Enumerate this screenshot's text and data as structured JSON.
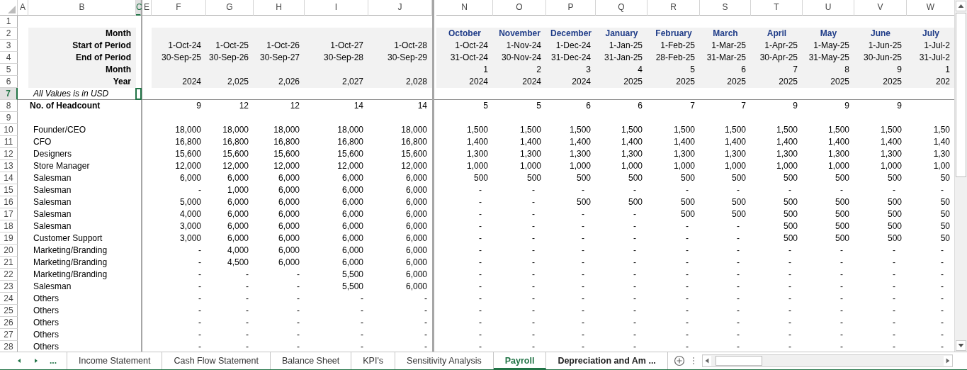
{
  "column_headers": [
    {
      "label": "A",
      "selected": false
    },
    {
      "label": "B",
      "selected": false
    },
    {
      "label": "C",
      "selected": true
    },
    {
      "label": "E",
      "selected": false
    },
    {
      "label": "F",
      "selected": false
    },
    {
      "label": "G",
      "selected": false
    },
    {
      "label": "H",
      "selected": false
    },
    {
      "label": "I",
      "selected": false
    },
    {
      "label": "J",
      "selected": false
    },
    {
      "label": "N",
      "selected": false
    },
    {
      "label": "O",
      "selected": false
    },
    {
      "label": "P",
      "selected": false
    },
    {
      "label": "Q",
      "selected": false
    },
    {
      "label": "R",
      "selected": false
    },
    {
      "label": "S",
      "selected": false
    },
    {
      "label": "T",
      "selected": false
    },
    {
      "label": "U",
      "selected": false
    },
    {
      "label": "V",
      "selected": false
    },
    {
      "label": "W",
      "selected": false
    }
  ],
  "row_numbers": [
    {
      "label": "1",
      "selected": false
    },
    {
      "label": "2",
      "selected": false
    },
    {
      "label": "3",
      "selected": false
    },
    {
      "label": "4",
      "selected": false
    },
    {
      "label": "5",
      "selected": false
    },
    {
      "label": "6",
      "selected": false
    },
    {
      "label": "7",
      "selected": true
    },
    {
      "label": "8",
      "selected": false
    },
    {
      "label": "9",
      "selected": false
    },
    {
      "label": "10",
      "selected": false
    },
    {
      "label": "11",
      "selected": false
    },
    {
      "label": "12",
      "selected": false
    },
    {
      "label": "13",
      "selected": false
    },
    {
      "label": "14",
      "selected": false
    },
    {
      "label": "15",
      "selected": false
    },
    {
      "label": "16",
      "selected": false
    },
    {
      "label": "17",
      "selected": false
    },
    {
      "label": "18",
      "selected": false
    },
    {
      "label": "19",
      "selected": false
    },
    {
      "label": "20",
      "selected": false
    },
    {
      "label": "21",
      "selected": false
    },
    {
      "label": "22",
      "selected": false
    },
    {
      "label": "23",
      "selected": false
    },
    {
      "label": "24",
      "selected": false
    },
    {
      "label": "25",
      "selected": false
    },
    {
      "label": "26",
      "selected": false
    },
    {
      "label": "27",
      "selected": false
    },
    {
      "label": "28",
      "selected": false
    }
  ],
  "period_header": {
    "labels": [
      "Month",
      "Start of Period",
      "End of Period",
      "Month",
      "Year"
    ],
    "annual": [
      {
        "start": "1-Oct-24",
        "end": "30-Sep-25",
        "year": "2024"
      },
      {
        "start": "1-Oct-25",
        "end": "30-Sep-26",
        "year": "2,025"
      },
      {
        "start": "1-Oct-26",
        "end": "30-Sep-27",
        "year": "2,026"
      },
      {
        "start": "1-Oct-27",
        "end": "30-Sep-28",
        "year": "2,027"
      },
      {
        "start": "1-Oct-28",
        "end": "30-Sep-29",
        "year": "2,028"
      }
    ],
    "monthly": [
      {
        "month": "October",
        "start": "1-Oct-24",
        "end": "31-Oct-24",
        "index": "1",
        "year": "2024"
      },
      {
        "month": "November",
        "start": "1-Nov-24",
        "end": "30-Nov-24",
        "index": "2",
        "year": "2024"
      },
      {
        "month": "December",
        "start": "1-Dec-24",
        "end": "31-Dec-24",
        "index": "3",
        "year": "2024"
      },
      {
        "month": "January",
        "start": "1-Jan-25",
        "end": "31-Jan-25",
        "index": "4",
        "year": "2025"
      },
      {
        "month": "February",
        "start": "1-Feb-25",
        "end": "28-Feb-25",
        "index": "5",
        "year": "2025"
      },
      {
        "month": "March",
        "start": "1-Mar-25",
        "end": "31-Mar-25",
        "index": "6",
        "year": "2025"
      },
      {
        "month": "April",
        "start": "1-Apr-25",
        "end": "30-Apr-25",
        "index": "7",
        "year": "2025"
      },
      {
        "month": "May",
        "start": "1-May-25",
        "end": "31-May-25",
        "index": "8",
        "year": "2025"
      },
      {
        "month": "June",
        "start": "1-Jun-25",
        "end": "30-Jun-25",
        "index": "9",
        "year": "2025"
      },
      {
        "month": "July",
        "start": "1-Jul-2",
        "end": "31-Jul-2",
        "index": "1",
        "year": "202"
      }
    ]
  },
  "note": "All Values is in USD",
  "headcount": {
    "label": "No. of Headcount",
    "annual": [
      "9",
      "12",
      "12",
      "14",
      "14"
    ],
    "monthly": [
      "5",
      "5",
      "6",
      "6",
      "7",
      "7",
      "9",
      "9",
      "9"
    ]
  },
  "rows": [
    {
      "label": "Founder/CEO",
      "annual": [
        "18,000",
        "18,000",
        "18,000",
        "18,000",
        "18,000"
      ],
      "monthly": [
        "1,500",
        "1,500",
        "1,500",
        "1,500",
        "1,500",
        "1,500",
        "1,500",
        "1,500",
        "1,500",
        "1,50"
      ]
    },
    {
      "label": "CFO",
      "annual": [
        "16,800",
        "16,800",
        "16,800",
        "16,800",
        "16,800"
      ],
      "monthly": [
        "1,400",
        "1,400",
        "1,400",
        "1,400",
        "1,400",
        "1,400",
        "1,400",
        "1,400",
        "1,400",
        "1,40"
      ]
    },
    {
      "label": "Designers",
      "annual": [
        "15,600",
        "15,600",
        "15,600",
        "15,600",
        "15,600"
      ],
      "monthly": [
        "1,300",
        "1,300",
        "1,300",
        "1,300",
        "1,300",
        "1,300",
        "1,300",
        "1,300",
        "1,300",
        "1,30"
      ]
    },
    {
      "label": "Store Manager",
      "annual": [
        "12,000",
        "12,000",
        "12,000",
        "12,000",
        "12,000"
      ],
      "monthly": [
        "1,000",
        "1,000",
        "1,000",
        "1,000",
        "1,000",
        "1,000",
        "1,000",
        "1,000",
        "1,000",
        "1,00"
      ]
    },
    {
      "label": "Salesman",
      "annual": [
        "6,000",
        "6,000",
        "6,000",
        "6,000",
        "6,000"
      ],
      "monthly": [
        "500",
        "500",
        "500",
        "500",
        "500",
        "500",
        "500",
        "500",
        "500",
        "50"
      ]
    },
    {
      "label": "Salesman",
      "annual": [
        "-",
        "1,000",
        "6,000",
        "6,000",
        "6,000"
      ],
      "monthly": [
        "-",
        "-",
        "-",
        "-",
        "-",
        "-",
        "-",
        "-",
        "-",
        "-"
      ]
    },
    {
      "label": "Salesman",
      "annual": [
        "5,000",
        "6,000",
        "6,000",
        "6,000",
        "6,000"
      ],
      "monthly": [
        "-",
        "-",
        "500",
        "500",
        "500",
        "500",
        "500",
        "500",
        "500",
        "50"
      ]
    },
    {
      "label": "Salesman",
      "annual": [
        "4,000",
        "6,000",
        "6,000",
        "6,000",
        "6,000"
      ],
      "monthly": [
        "-",
        "-",
        "-",
        "-",
        "500",
        "500",
        "500",
        "500",
        "500",
        "50"
      ]
    },
    {
      "label": "Salesman",
      "annual": [
        "3,000",
        "6,000",
        "6,000",
        "6,000",
        "6,000"
      ],
      "monthly": [
        "-",
        "-",
        "-",
        "-",
        "-",
        "-",
        "500",
        "500",
        "500",
        "50"
      ]
    },
    {
      "label": "Customer Support",
      "annual": [
        "3,000",
        "6,000",
        "6,000",
        "6,000",
        "6,000"
      ],
      "monthly": [
        "-",
        "-",
        "-",
        "-",
        "-",
        "-",
        "500",
        "500",
        "500",
        "50"
      ]
    },
    {
      "label": "Marketing/Branding",
      "annual": [
        "-",
        "4,000",
        "6,000",
        "6,000",
        "6,000"
      ],
      "monthly": [
        "-",
        "-",
        "-",
        "-",
        "-",
        "-",
        "-",
        "-",
        "-",
        "-"
      ]
    },
    {
      "label": "Marketing/Branding",
      "annual": [
        "-",
        "4,500",
        "6,000",
        "6,000",
        "6,000"
      ],
      "monthly": [
        "-",
        "-",
        "-",
        "-",
        "-",
        "-",
        "-",
        "-",
        "-",
        "-"
      ]
    },
    {
      "label": "Marketing/Branding",
      "annual": [
        "-",
        "-",
        "-",
        "5,500",
        "6,000"
      ],
      "monthly": [
        "-",
        "-",
        "-",
        "-",
        "-",
        "-",
        "-",
        "-",
        "-",
        "-"
      ]
    },
    {
      "label": "Salesman",
      "annual": [
        "-",
        "-",
        "-",
        "5,500",
        "6,000"
      ],
      "monthly": [
        "-",
        "-",
        "-",
        "-",
        "-",
        "-",
        "-",
        "-",
        "-",
        "-"
      ]
    },
    {
      "label": "Others",
      "annual": [
        "-",
        "-",
        "-",
        "-",
        "-"
      ],
      "monthly": [
        "-",
        "-",
        "-",
        "-",
        "-",
        "-",
        "-",
        "-",
        "-",
        "-"
      ]
    },
    {
      "label": "Others",
      "annual": [
        "-",
        "-",
        "-",
        "-",
        "-"
      ],
      "monthly": [
        "-",
        "-",
        "-",
        "-",
        "-",
        "-",
        "-",
        "-",
        "-",
        "-"
      ]
    },
    {
      "label": "Others",
      "annual": [
        "-",
        "-",
        "-",
        "-",
        "-"
      ],
      "monthly": [
        "-",
        "-",
        "-",
        "-",
        "-",
        "-",
        "-",
        "-",
        "-",
        "-"
      ]
    },
    {
      "label": "Others",
      "annual": [
        "-",
        "-",
        "-",
        "-",
        "-"
      ],
      "monthly": [
        "-",
        "-",
        "-",
        "-",
        "-",
        "-",
        "-",
        "-",
        "-",
        "-"
      ]
    },
    {
      "label": "Others",
      "annual": [
        "-",
        "-",
        "-",
        "-",
        "-"
      ],
      "monthly": [
        "-",
        "-",
        "-",
        "-",
        "-",
        "-",
        "-",
        "-",
        "-",
        "-"
      ]
    }
  ],
  "sheet_nav": {
    "more": "..."
  },
  "sheet_tabs": [
    {
      "label": "Income Statement",
      "selected": false,
      "bold": false
    },
    {
      "label": "Cash Flow Statement",
      "selected": false,
      "bold": false
    },
    {
      "label": "Balance Sheet",
      "selected": false,
      "bold": false
    },
    {
      "label": "KPI's",
      "selected": false,
      "bold": false
    },
    {
      "label": "Sensitivity Analysis",
      "selected": false,
      "bold": false
    },
    {
      "label": "Payroll",
      "selected": true,
      "bold": true
    },
    {
      "label": "Depreciation and Am ...",
      "selected": false,
      "bold": true
    }
  ]
}
